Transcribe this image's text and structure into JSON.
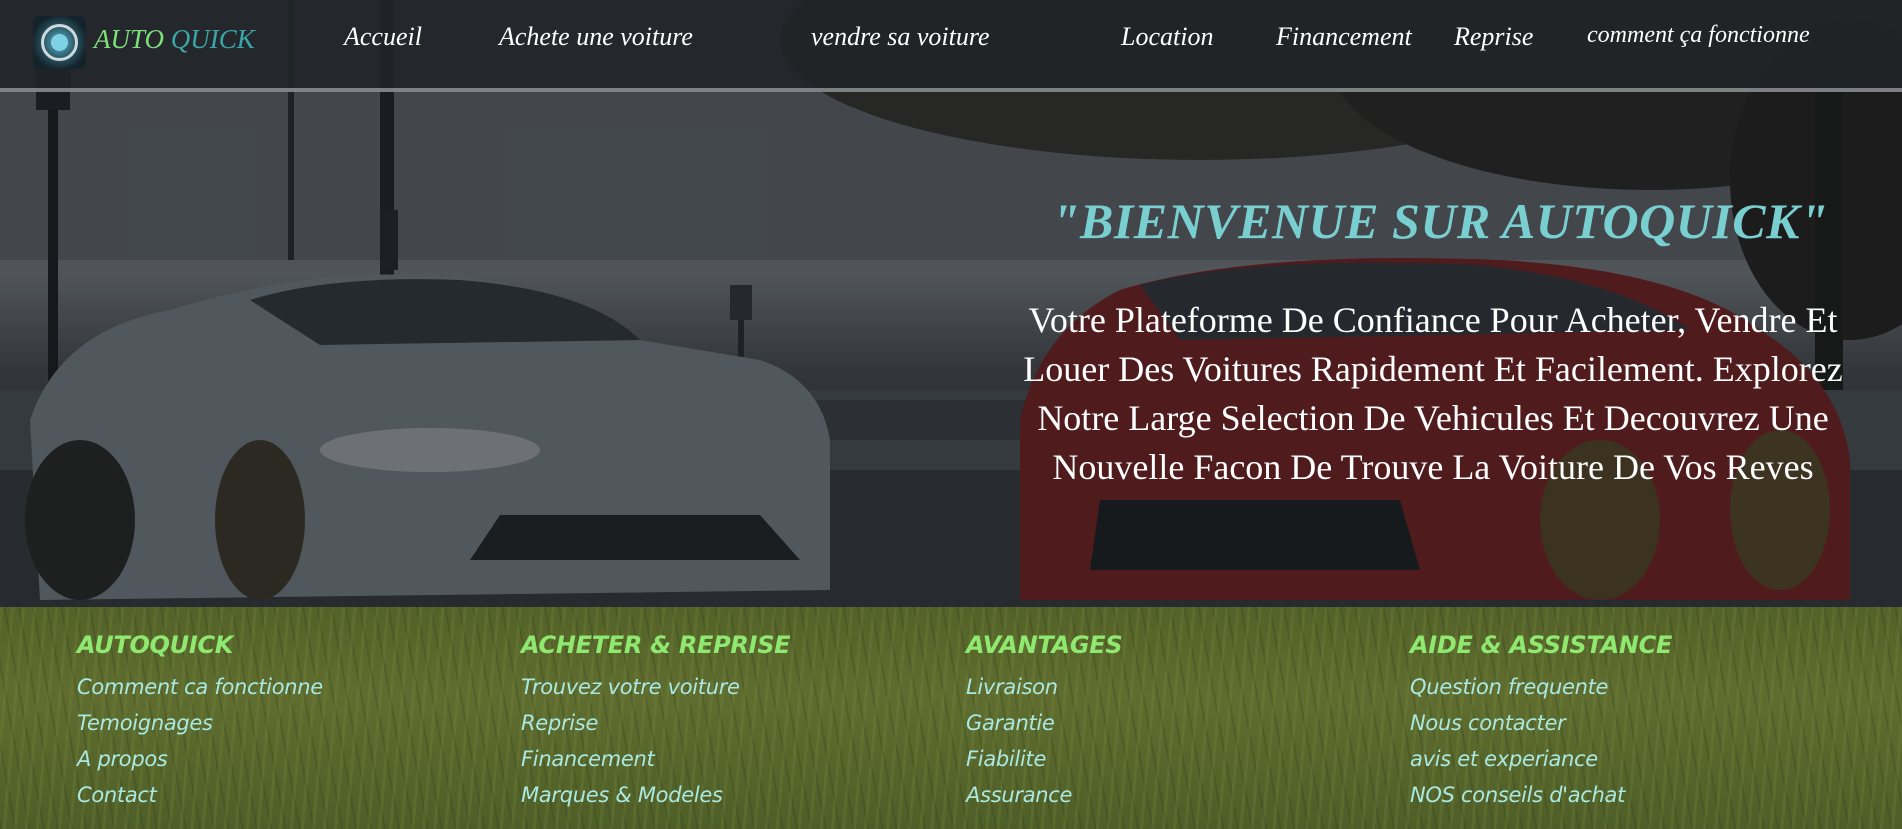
{
  "brand": {
    "part1": "AUTO",
    "part2": "QUICK",
    "logo_icon": "logo-badge-icon",
    "colors": {
      "auto": "#7fe07a",
      "quick": "#3aa6a6"
    }
  },
  "nav": {
    "items": [
      {
        "label": "Accueil"
      },
      {
        "label": "Achete une voiture"
      },
      {
        "label": "vendre sa voiture"
      },
      {
        "label": "Location"
      },
      {
        "label": "Financement"
      },
      {
        "label": "Reprise"
      },
      {
        "label": "comment ça fonctionne"
      }
    ]
  },
  "hero": {
    "title": "\"BIENVENUE SUR AUTOQUICK\"",
    "text_lines": [
      "Votre Plateforme De Confiance Pour Acheter, Vendre Et",
      "Louer Des Voitures Rapidement Et Facilement. Explorez",
      "Notre Large Selection De Vehicules Et Decouvrez Une",
      "Nouvelle Facon De Trouve La Voiture De Vos Reves"
    ],
    "title_color": "#79cfd0"
  },
  "footer": {
    "columns": [
      {
        "heading": "AUTOQUICK",
        "links": [
          "Comment ca fonctionne",
          "Temoignages",
          "A propos",
          "Contact"
        ]
      },
      {
        "heading": "ACHETER & REPRISE",
        "links": [
          "Trouvez votre voiture",
          "Reprise",
          "Financement",
          "Marques & Modeles"
        ]
      },
      {
        "heading": "AVANTAGES",
        "links": [
          "Livraison",
          "Garantie",
          "Fiabilite",
          "Assurance"
        ]
      },
      {
        "heading": "AIDE & ASSISTANCE",
        "links": [
          "Question frequente",
          "Nous contacter",
          "avis et experiance",
          "NOS conseils d'achat"
        ]
      }
    ],
    "heading_color": "#8fe86f",
    "link_color": "#a9e9e0"
  }
}
